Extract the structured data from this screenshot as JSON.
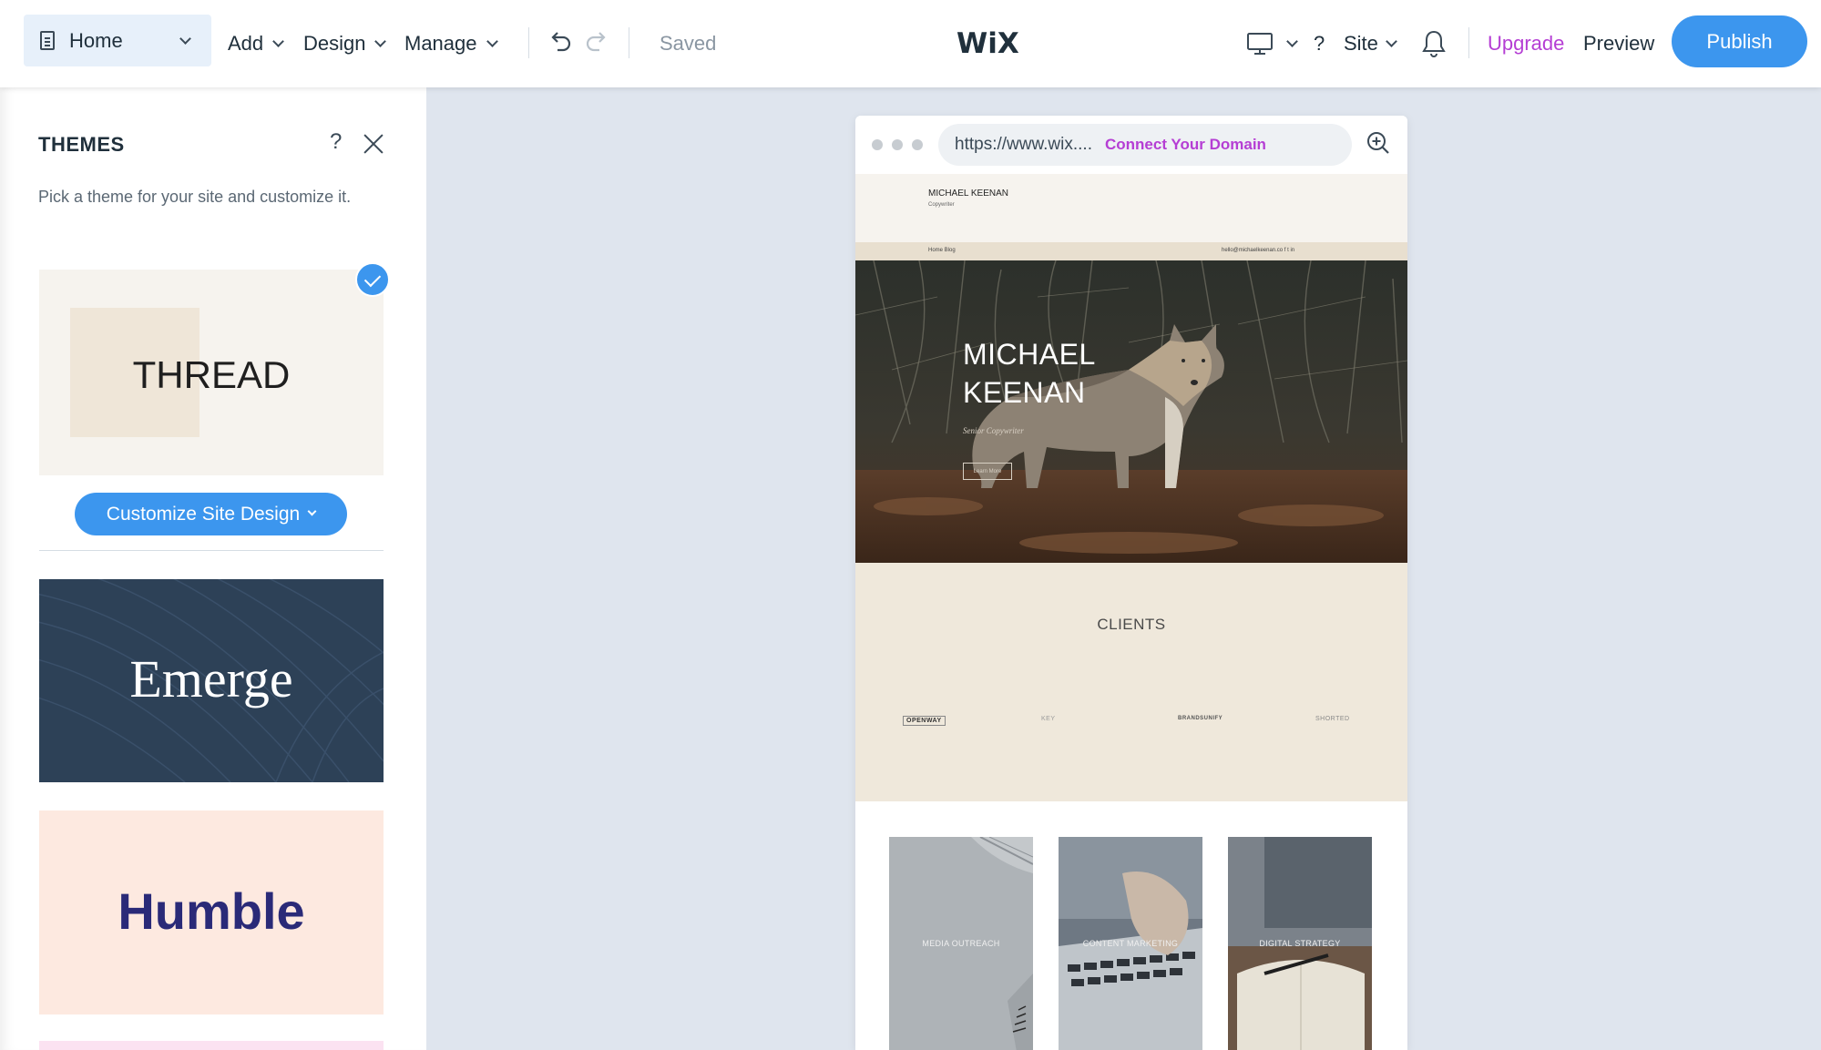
{
  "topbar": {
    "page_selector": "Home",
    "menu": {
      "add": "Add",
      "design": "Design",
      "manage": "Manage"
    },
    "saved_status": "Saved",
    "logo": "WiX",
    "help": "?",
    "site_menu": "Site",
    "upgrade": "Upgrade",
    "preview": "Preview",
    "publish": "Publish",
    "colors": {
      "accent": "#3c96ee",
      "upgrade": "#b53ed4"
    }
  },
  "themes_panel": {
    "title": "THEMES",
    "help": "?",
    "subtitle": "Pick a theme for your site and customize it.",
    "customize_button": "Customize Site Design",
    "themes": [
      {
        "name": "THREAD",
        "selected": true
      },
      {
        "name": "Emerge",
        "selected": false
      },
      {
        "name": "Humble",
        "selected": false
      }
    ]
  },
  "preview": {
    "url": "https://www.wix....",
    "connect_domain": "Connect Your Domain",
    "site": {
      "name": "MICHAEL KEENAN",
      "role": "Copywriter",
      "nav": "Home    Blog",
      "contact": "hello@michaelkeenan.co   f  t  in",
      "hero_line1": "MICHAEL",
      "hero_line2": "KEENAN",
      "hero_role": "Senior Copywriter",
      "hero_button": "Learn More",
      "clients_title": "CLIENTS",
      "client_logos": [
        "OPENWAY",
        "KEY",
        "BRANDSUNIFY",
        "SHORTED"
      ],
      "services": [
        "MEDIA OUTREACH",
        "CONTENT MARKETING",
        "DIGITAL STRATEGY"
      ]
    }
  }
}
